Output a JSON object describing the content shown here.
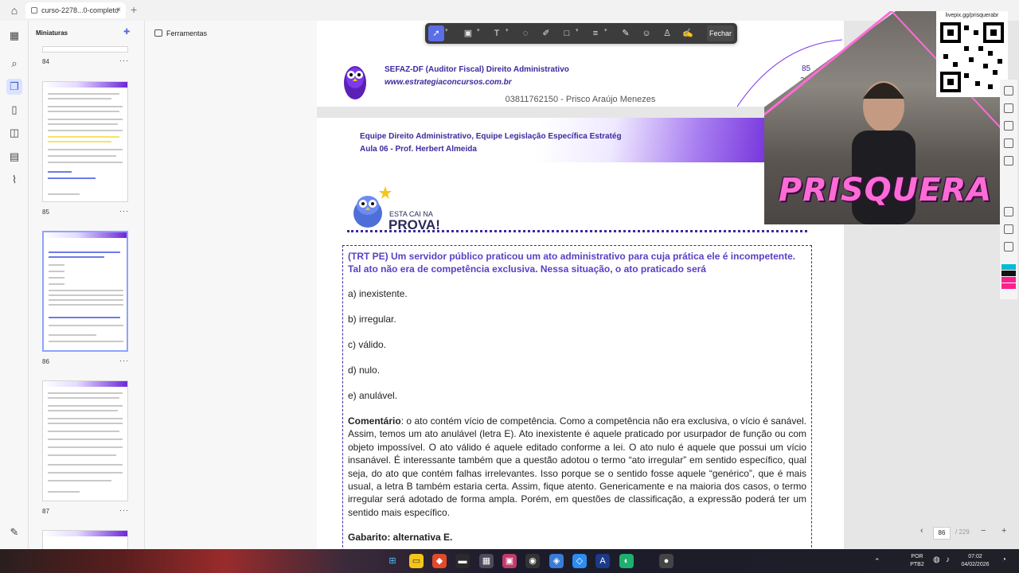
{
  "browser": {
    "tab_title": "curso-2278...0-completo",
    "close_glyph": "×",
    "new_tab_glyph": "+"
  },
  "rail": {
    "icons": [
      "home-icon",
      "apps-grid-icon",
      "search-icon",
      "thumbnails-icon",
      "bookmark-icon",
      "comment-icon",
      "layers-icon",
      "attachment-icon",
      "signature-icon"
    ]
  },
  "thumbnails": {
    "header": "Miniaturas",
    "more_glyph": "···",
    "pages": [
      "84",
      "85",
      "86",
      "87"
    ]
  },
  "tools": {
    "label": "Ferramentas"
  },
  "toolbar": {
    "close_label": "Fechar"
  },
  "page85": {
    "title": "SEFAZ-DF (Auditor Fiscal) Direito Administrativo",
    "site": "www.estrategiaconcursos.com.br",
    "page_number": "85",
    "page_total": "229",
    "watermark": "03811762150 - Prisco Araújo Menezes"
  },
  "page86": {
    "header_line1": "Equipe Direito Administrativo, Equipe Legislação Específica Estratég",
    "header_line2": "Aula 06 - Prof. Herbert Almeida",
    "logo_small": "ESTA CAI NA",
    "logo_big": "PROVA!",
    "question": "(TRT PE) Um servidor público praticou um ato administrativo para cuja prática ele é incompetente. Tal ato não era de competência exclusiva. Nessa situação, o ato praticado será",
    "options": [
      "a) inexistente.",
      "b) irregular.",
      "c) válido.",
      "d) nulo.",
      "e) anulável."
    ],
    "comment_label": "Comentário",
    "comment_text": ": o ato contém vício de competência. Como a competência não era exclusiva, o vício é sanável. Assim, temos um ato anulável (letra E). Ato inexistente é aquele praticado por usurpador de função ou com objeto impossível. O ato válido é aquele editado conforme a lei. O ato nulo é aquele que possui um vício insanável. É interessante também que a questão adotou o termo “ato irregular” em sentido específico, qual seja, do ato que contém falhas irrelevantes. Isso porque se o sentido fosse aquele “genérico”, que é mais usual, a letra B também estaria certa. Assim, fique atento. Genericamente e na maioria dos casos, o termo irregular será adotado de forma ampla. Porém, em questões de classificação, a expressão poderá ter um sentido mais específico.",
    "answer": "Gabarito: alternativa E."
  },
  "overlay": {
    "brand": "PRISQUERA",
    "qr_caption": "livepix.gg/prisquerabr"
  },
  "page_nav": {
    "current": "86",
    "total": "/ 229"
  },
  "taskbar": {
    "lang_line1": "POR",
    "lang_line2": "PTB2",
    "time": "07:02",
    "date": "04/02/2026"
  },
  "colors": {
    "accent": "#3b2a9e",
    "question": "#5b3fc4",
    "band_purple": "#6d28d9",
    "brand_pink": "#ff6bd6"
  }
}
